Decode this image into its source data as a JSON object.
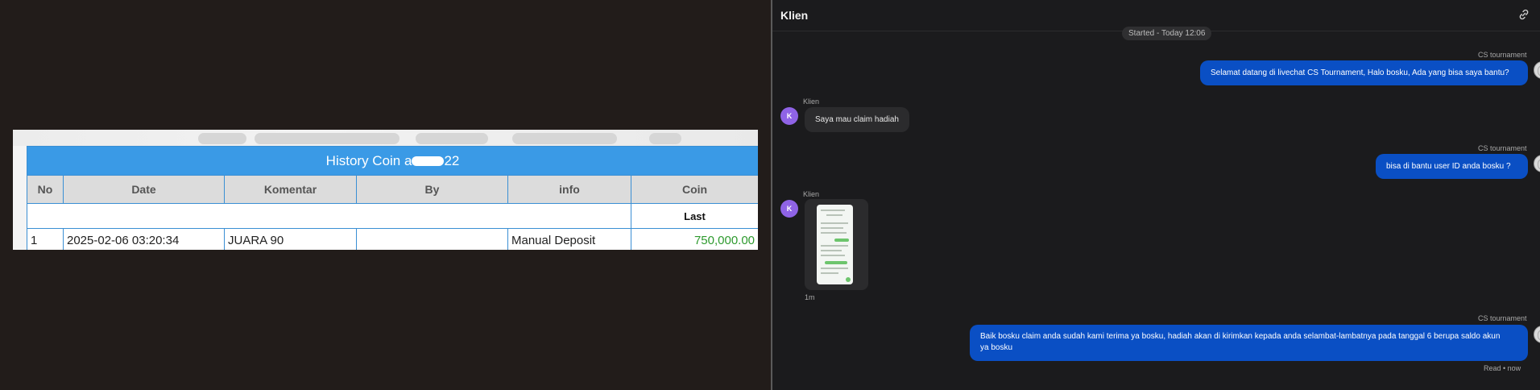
{
  "history_table": {
    "title_prefix": "History Coin a",
    "title_suffix": "22",
    "columns": [
      "No",
      "Date",
      "Komentar",
      "By",
      "info",
      "Coin"
    ],
    "sub_header": "Last",
    "rows": [
      {
        "no": "1",
        "date": "2025-02-06 03:20:34",
        "komentar": "JUARA 90",
        "by": "",
        "info": "Manual Deposit",
        "coin": "750,000.00"
      }
    ]
  },
  "chat": {
    "header_title": "Klien",
    "started_label": "Started - Today 12:06",
    "agent_name": "CS tournament",
    "client_name": "Klien",
    "client_avatar_letter": "K",
    "messages": [
      {
        "from": "agent",
        "text": "Selamat datang di livechat CS Tournament, Halo bosku, Ada yang bisa saya bantu?"
      },
      {
        "from": "client",
        "text": "Saya mau claim hadiah"
      },
      {
        "from": "agent",
        "text": "bisa di bantu user ID anda bosku ?"
      },
      {
        "from": "client",
        "type": "image",
        "time": "1m"
      },
      {
        "from": "agent",
        "text_line1": "Baik bosku claim anda sudah kami terima ya bosku, hadiah akan di kirimkan kepada anda selambat-lambatnya pada tanggal 6 berupa saldo akun",
        "text_line2": "ya bosku"
      }
    ],
    "read_status": "Read • now"
  },
  "colors": {
    "table_title_bg": "#3a9ae6",
    "coin_green": "#2e9a2e",
    "agent_bubble": "#0a4fc4",
    "client_bubble": "#2b2b2d",
    "client_avatar": "#8f63e6"
  }
}
